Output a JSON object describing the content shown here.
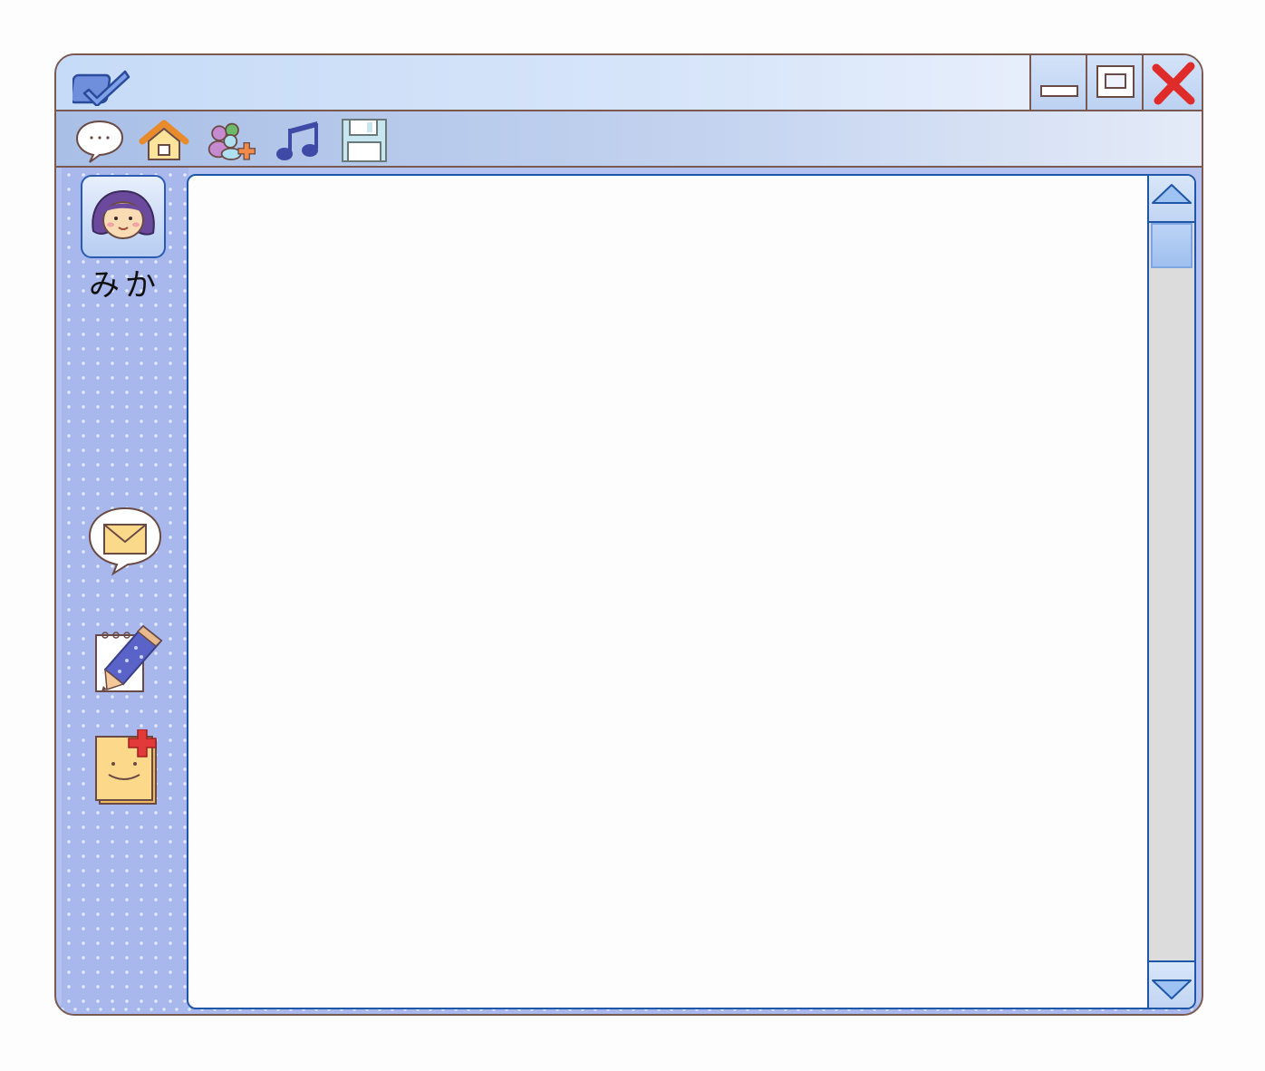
{
  "titlebar": {
    "app_icon": "checkbox-icon",
    "controls": [
      "minimize-icon",
      "maximize-icon",
      "close-icon"
    ]
  },
  "toolbar": {
    "tools": [
      "chat-bubble-icon",
      "home-icon",
      "add-contact-icon",
      "music-icon",
      "save-icon"
    ]
  },
  "sidebar": {
    "profile": {
      "avatar": "girl-avatar-icon",
      "name": "みか"
    },
    "actions": [
      "mail-bubble-icon",
      "notepad-pencil-icon",
      "add-sticker-icon"
    ]
  },
  "colors": {
    "frame": "#7a5a50",
    "accent": "#1e56a8",
    "sidebar": "#a8b8ec",
    "close": "#e02b2b"
  }
}
